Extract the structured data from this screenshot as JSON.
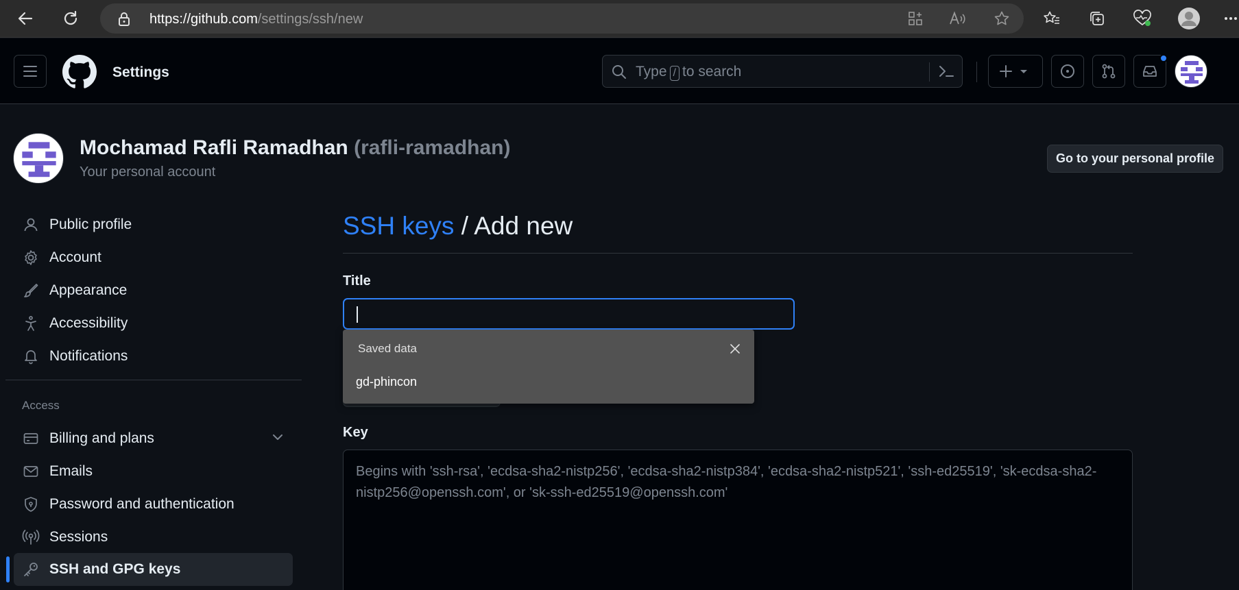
{
  "browser": {
    "url_host": "https://github.com",
    "url_path": "/settings/ssh/new"
  },
  "header": {
    "title": "Settings",
    "search_prefix": "Type",
    "search_key": "/",
    "search_suffix": "to search"
  },
  "account": {
    "name": "Mochamad Rafli Ramadhan",
    "login": "(rafli-ramadhan)",
    "subtitle": "Your personal account",
    "profile_button": "Go to your personal profile"
  },
  "sidebar": {
    "items": [
      {
        "label": "Public profile",
        "icon": "person-icon"
      },
      {
        "label": "Account",
        "icon": "gear-icon"
      },
      {
        "label": "Appearance",
        "icon": "paintbrush-icon"
      },
      {
        "label": "Accessibility",
        "icon": "accessibility-icon"
      },
      {
        "label": "Notifications",
        "icon": "bell-icon"
      }
    ],
    "access_heading": "Access",
    "access_items": [
      {
        "label": "Billing and plans",
        "icon": "credit-card-icon"
      },
      {
        "label": "Emails",
        "icon": "mail-icon"
      },
      {
        "label": "Password and authentication",
        "icon": "shield-lock-icon"
      },
      {
        "label": "Sessions",
        "icon": "broadcast-icon"
      },
      {
        "label": "SSH and GPG keys",
        "icon": "key-icon",
        "active": true
      }
    ]
  },
  "main": {
    "breadcrumb_link": "SSH keys",
    "breadcrumb_sep": "/",
    "breadcrumb_current": "Add new",
    "title_label": "Title",
    "title_value": "",
    "key_label": "Key",
    "key_placeholder": "Begins with 'ssh-rsa', 'ecdsa-sha2-nistp256', 'ecdsa-sha2-nistp384', 'ecdsa-sha2-nistp521', 'ssh-ed25519', 'sk-ecdsa-sha2-nistp256@openssh.com', or 'sk-ssh-ed25519@openssh.com'"
  },
  "autofill": {
    "heading": "Saved data",
    "items": [
      "gd-phincon"
    ]
  },
  "colors": {
    "accent": "#2f81f7",
    "background": "#0d1117",
    "header": "#010409",
    "avatar_purple": "#6e5acd"
  }
}
